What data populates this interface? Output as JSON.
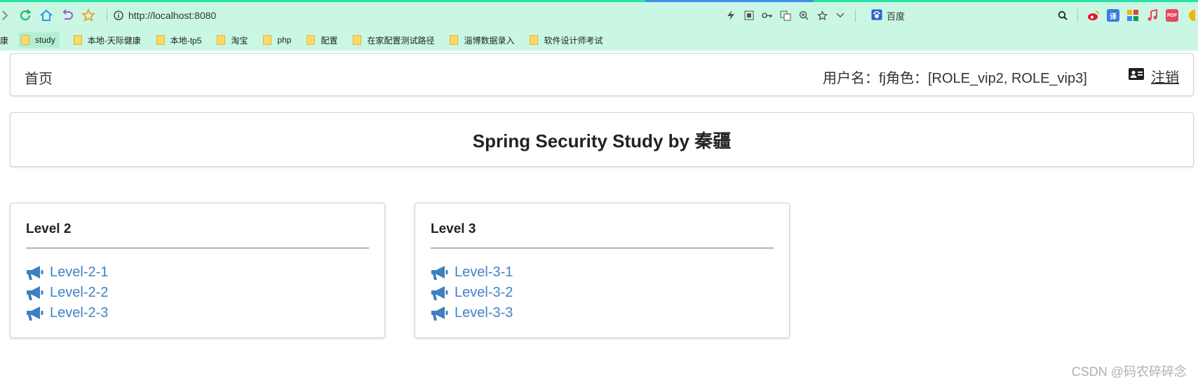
{
  "browser": {
    "url": "http://localhost:8080",
    "search_engine": "百度",
    "partial_left_bookmark": "康",
    "bookmarks": [
      {
        "label": "study",
        "active": true
      },
      {
        "label": "本地-天际健康"
      },
      {
        "label": "本地-tp5"
      },
      {
        "label": "淘宝"
      },
      {
        "label": "php"
      },
      {
        "label": "配置"
      },
      {
        "label": "在家配置测试路径"
      },
      {
        "label": "淄博数据录入"
      },
      {
        "label": "软件设计师考试"
      }
    ],
    "ext_translate": "译",
    "ext_pdf": "PDF"
  },
  "nav": {
    "home": "首页",
    "user_info": "用户名：fj角色：[ROLE_vip2, ROLE_vip3]",
    "logout": "注销"
  },
  "title": "Spring Security Study by 秦疆",
  "cards": [
    {
      "heading": "Level 2",
      "links": [
        "Level-2-1",
        "Level-2-2",
        "Level-2-3"
      ]
    },
    {
      "heading": "Level 3",
      "links": [
        "Level-3-1",
        "Level-3-2",
        "Level-3-3"
      ]
    }
  ],
  "watermark": "CSDN @码农碎碎念",
  "colors": {
    "link": "#4183c4",
    "chrome_bg": "#c9f7e3"
  }
}
